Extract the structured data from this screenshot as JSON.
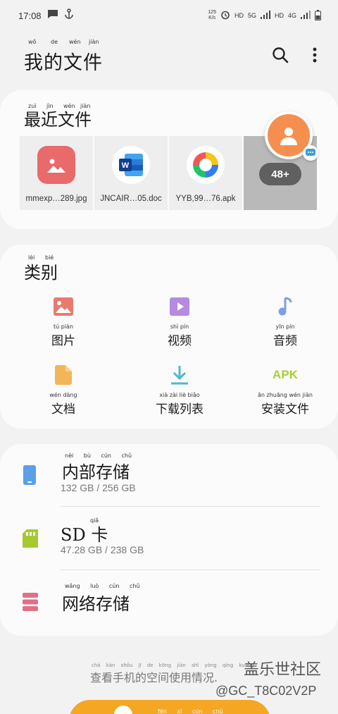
{
  "status_bar": {
    "time": "17:08",
    "net_speed_value": "125",
    "net_speed_unit": "K/s",
    "hd1": "HD",
    "net1": "5G",
    "hd2": "HD",
    "net2": "4G"
  },
  "app_bar": {
    "title": "我的文件",
    "title_pinyin": [
      "wǒ",
      "de",
      "wén",
      "jiàn"
    ]
  },
  "recent": {
    "title": "最近文件",
    "title_pinyin": [
      "zuì",
      "jìn",
      "wén",
      "jiàn"
    ],
    "files": [
      {
        "name": "mmexp…289.jpg",
        "icon": "image-icon",
        "color": "#e86a6a"
      },
      {
        "name": "JNCAIR…05.doc",
        "icon": "word-icon",
        "color": "#2b6cd6"
      },
      {
        "name": "YYB,99…76.apk",
        "icon": "appstore-icon",
        "color": "#ffffff"
      }
    ],
    "more_label": "48+"
  },
  "categories": {
    "title": "类别",
    "title_pinyin": [
      "lèi",
      "bié"
    ],
    "items": [
      {
        "label": "图片",
        "pinyin": "tú piàn",
        "icon": "image-icon",
        "color": "#e87a6e"
      },
      {
        "label": "视频",
        "pinyin": "shì pín",
        "icon": "video-icon",
        "color": "#b58ae0"
      },
      {
        "label": "音频",
        "pinyin": "yīn pín",
        "icon": "music-icon",
        "color": "#7d9de8"
      },
      {
        "label": "文档",
        "pinyin": "wén dàng",
        "icon": "document-icon",
        "color": "#f2b659"
      },
      {
        "label": "下载列表",
        "pinyin": "xià zài liè biǎo",
        "icon": "download-icon",
        "color": "#4fb8c9"
      },
      {
        "label": "安装文件",
        "pinyin": "ān zhuāng wén jiàn",
        "icon": "apk-icon",
        "color": "#a8d030",
        "icon_text": "APK"
      }
    ]
  },
  "storage": {
    "internal": {
      "title": "内部存储",
      "pinyin": "nèi bù cún chǔ",
      "usage": "132 GB / 256 GB",
      "color": "#5aa0e8"
    },
    "sd": {
      "title": "SD 卡",
      "pinyin": "qiǎ",
      "usage": "47.28 GB / 238 GB",
      "color": "#a6c832"
    },
    "network": {
      "title": "网络存储",
      "pinyin": "wǎng luò cún chǔ",
      "color": "#e07088"
    }
  },
  "footer": {
    "text": "查看手机的空间使用情况.",
    "text_pinyin": "chá kàn shǒu jī de kōng jiān shǐ yòng qíng kuàng",
    "brand": "盖乐世社区",
    "handle": "@GC_T8C02V2P",
    "button_pinyin": "fēn xī cún chǔ"
  },
  "colors": {
    "background": "#f2f2f2",
    "card": "#fbfbfb",
    "accent_button": "#f5a623"
  }
}
